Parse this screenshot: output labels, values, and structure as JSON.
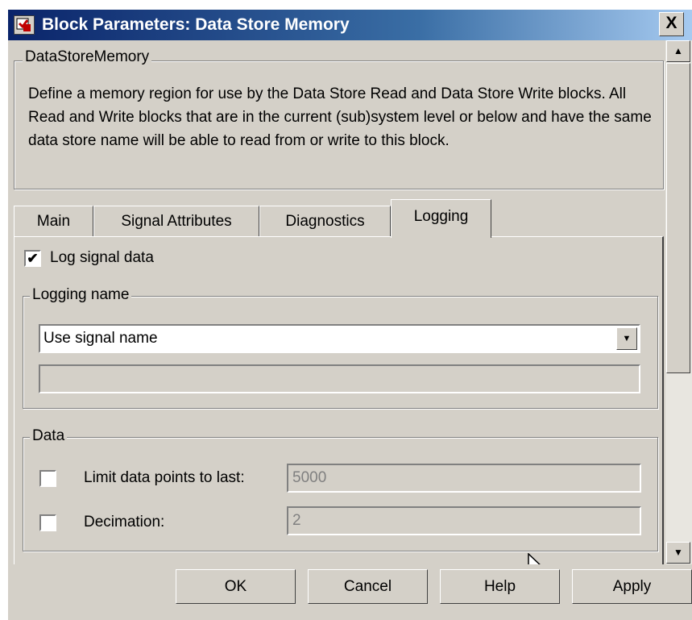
{
  "window": {
    "title": "Block Parameters: Data Store Memory",
    "close_glyph": "X"
  },
  "block_group": {
    "label": "DataStoreMemory",
    "description": "Define a memory region for use by the Data Store Read and Data Store Write blocks. All Read and Write blocks that are in the current (sub)system level or below and have the same data store name will be able to read from or write to this block."
  },
  "tabs": [
    {
      "label": "Main",
      "active": false
    },
    {
      "label": "Signal Attributes",
      "active": false
    },
    {
      "label": "Diagnostics",
      "active": false
    },
    {
      "label": "Logging",
      "active": true
    }
  ],
  "logging": {
    "log_signal_data": {
      "label": "Log signal data",
      "checked": true,
      "mark": "✔"
    },
    "logging_name": {
      "group_label": "Logging name",
      "selected": "Use signal name",
      "custom_name_value": ""
    },
    "data": {
      "group_label": "Data",
      "limit": {
        "label": "Limit data points to last:",
        "checked": false,
        "value": "5000"
      },
      "decimation": {
        "label": "Decimation:",
        "checked": false,
        "value": "2"
      }
    }
  },
  "buttons": {
    "ok": "OK",
    "cancel": "Cancel",
    "help": "Help",
    "apply": "Apply"
  },
  "colors": {
    "dialog_bg": "#d4d0c8",
    "title_start": "#0a246a",
    "title_end": "#a6caf0"
  }
}
